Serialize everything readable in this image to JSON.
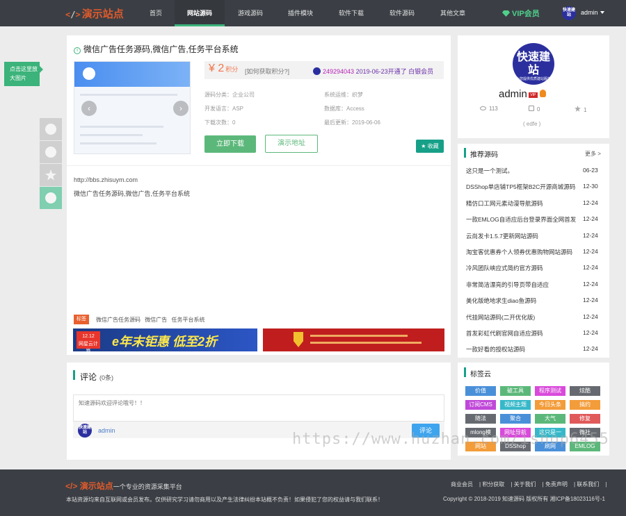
{
  "nav": {
    "logo": "演示站点",
    "items": [
      "首页",
      "网站源码",
      "游戏源码",
      "插件模块",
      "软件下载",
      "软件源码",
      "其他文章"
    ],
    "vip": "VIP会员",
    "user": "admin",
    "avatar_text": "快速建站"
  },
  "side": {
    "zoom_tip": "点击这里放大图片"
  },
  "product": {
    "title": "微信广告任务源码,微信广告,任务平台系统",
    "price": "¥ 2",
    "price_unit": "积分",
    "price_link": "[如何获取积分?]",
    "recent_id": "249294043",
    "recent_rest": "2019-06-23开通了 白银会员",
    "meta": {
      "category": "源码分类：企业公司",
      "system": "系统运维：织梦",
      "language": "开发语言：ASP",
      "database": "数据库：Access",
      "downloads": "下载次数：0",
      "updated": "最后更新：2019-06-06"
    },
    "download_btn": "立即下载",
    "demo_btn": "演示地址",
    "fav_btn": "收藏",
    "url": "http://bbs.zhisuym.com",
    "desc": "微信广告任务源码,微信广告,任务平台系统",
    "tag_label": "标签",
    "tags": [
      "微信广告任务源码",
      "微信广告",
      "任务平台系统"
    ]
  },
  "banners": {
    "badge": "12.12",
    "badge_sub": "网星云计算",
    "left_text": "e年末钜惠  低至2折"
  },
  "comment": {
    "title": "评论",
    "count": "(0条)",
    "placeholder": "知速源码欢迎评论哦号！！",
    "user": "admin",
    "submit": "评论"
  },
  "profile": {
    "avatar_text": "快速建站",
    "avatar_sub": "为您提供优质建站服务",
    "name": "admin",
    "vip": "VIP",
    "views": "113",
    "comments": "0",
    "likes": "1",
    "signature": "( edfe )"
  },
  "recommend": {
    "title": "推荐源码",
    "more": "更多 >",
    "items": [
      {
        "title": "这只是一个测试。",
        "date": "06-23"
      },
      {
        "title": "DSShop单店铺TP5框架B2C开源商城源码",
        "date": "12-30"
      },
      {
        "title": "精仿口工网元素动漫导航源码",
        "date": "12-24"
      },
      {
        "title": "一款EMLOG自适应后台登录界面全网首发",
        "date": "12-24"
      },
      {
        "title": "云尚发卡1.5.7更新网站源码",
        "date": "12-24"
      },
      {
        "title": "淘宝客优惠券个人领券优惠购物网站源码",
        "date": "12-24"
      },
      {
        "title": "冷风团队峡应式简约官方源码",
        "date": "12-24"
      },
      {
        "title": "非常简洁漂亮的引导页带自适应",
        "date": "12-24"
      },
      {
        "title": "美化版绝地求生diao鱼源码",
        "date": "12-24"
      },
      {
        "title": "代挂网站源码(二开优化版)",
        "date": "12-24"
      },
      {
        "title": "首发彩虹代刷官网自适应源码",
        "date": "12-24"
      },
      {
        "title": "一款好看的授权站源码",
        "date": "12-24"
      }
    ]
  },
  "tagcloud": {
    "title": "标签云",
    "tags": [
      {
        "label": "价值",
        "color": "#4a90d9"
      },
      {
        "label": "破工具",
        "color": "#5cb87a"
      },
      {
        "label": "程序测试",
        "color": "#d94adb"
      },
      {
        "label": "炫酷",
        "color": "#666a70"
      },
      {
        "label": "订阅CMS",
        "color": "#c048d9"
      },
      {
        "label": "视频主题",
        "color": "#36b8c9"
      },
      {
        "label": "今日头条",
        "color": "#f39c3a"
      },
      {
        "label": "搞约",
        "color": "#f39c3a"
      },
      {
        "label": "随法",
        "color": "#666a70"
      },
      {
        "label": "聚合",
        "color": "#4a90d9"
      },
      {
        "label": "大气",
        "color": "#5cb87a"
      },
      {
        "label": "修复",
        "color": "#e05a5a"
      },
      {
        "label": "mlong模",
        "color": "#666a70"
      },
      {
        "label": "网址导航",
        "color": "#d94adb"
      },
      {
        "label": "这只是一",
        "color": "#36b8c9"
      },
      {
        "label": "微社",
        "color": "#666a70"
      },
      {
        "label": "网站",
        "color": "#f39c3a"
      },
      {
        "label": "DSShop",
        "color": "#666a70"
      },
      {
        "label": "刷网",
        "color": "#4a90d9"
      },
      {
        "label": "EMLOG",
        "color": "#5cb87a"
      }
    ]
  },
  "footer": {
    "logo": "演示站点",
    "slogan": "一个专业的资源采集平台",
    "note": "本站资源均来自互联网或会员发布。仅供研究学习请勿商用以及产生法律纠纷本站概不负责！如果侵犯了您的权益请与我们联系！",
    "links": [
      "商业会员",
      "积分获取",
      "关于我们",
      "免责声明",
      "联系我们"
    ],
    "copyright": "Copyright © 2018-2019 知速源码 版权所有 湘ICP备18023116号-1"
  },
  "watermark": "https://www.huzhan.com/ishop6455"
}
